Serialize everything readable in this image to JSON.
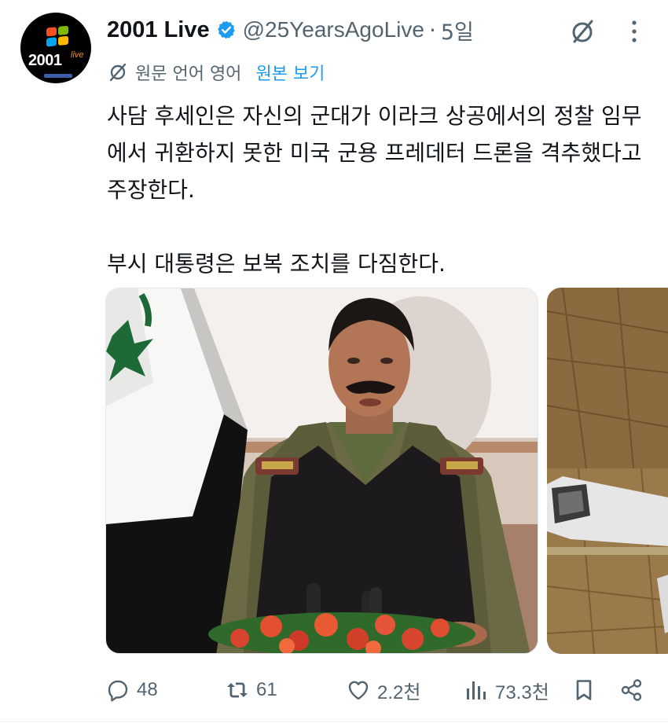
{
  "author": {
    "display_name": "2001 Live",
    "handle": "@25YearsAgoLive",
    "separator": "·",
    "time": "5일",
    "avatar_text": "2001",
    "avatar_sup": "live",
    "verified_icon": "verified-badge-icon"
  },
  "translation": {
    "label": "원문 언어 영어",
    "show_original": "원본 보기",
    "icon": "translate-icon"
  },
  "tweet": {
    "paragraph1": "사담 후세인은 자신의 군대가 이라크 상공에서의 정찰 임무에서 귀환하지 못한 미국 군용 프레데터 드론을 격추했다고 주장한다.",
    "paragraph2": "부시 대통령은 보복 조치를 다짐한다."
  },
  "actions": {
    "reply": "48",
    "retweet": "61",
    "like": "2.2천",
    "views": "73.3천"
  },
  "colors": {
    "text": "#0f1419",
    "secondary": "#536471",
    "link": "#1d9bf0",
    "verified": "#1d9bf0"
  }
}
